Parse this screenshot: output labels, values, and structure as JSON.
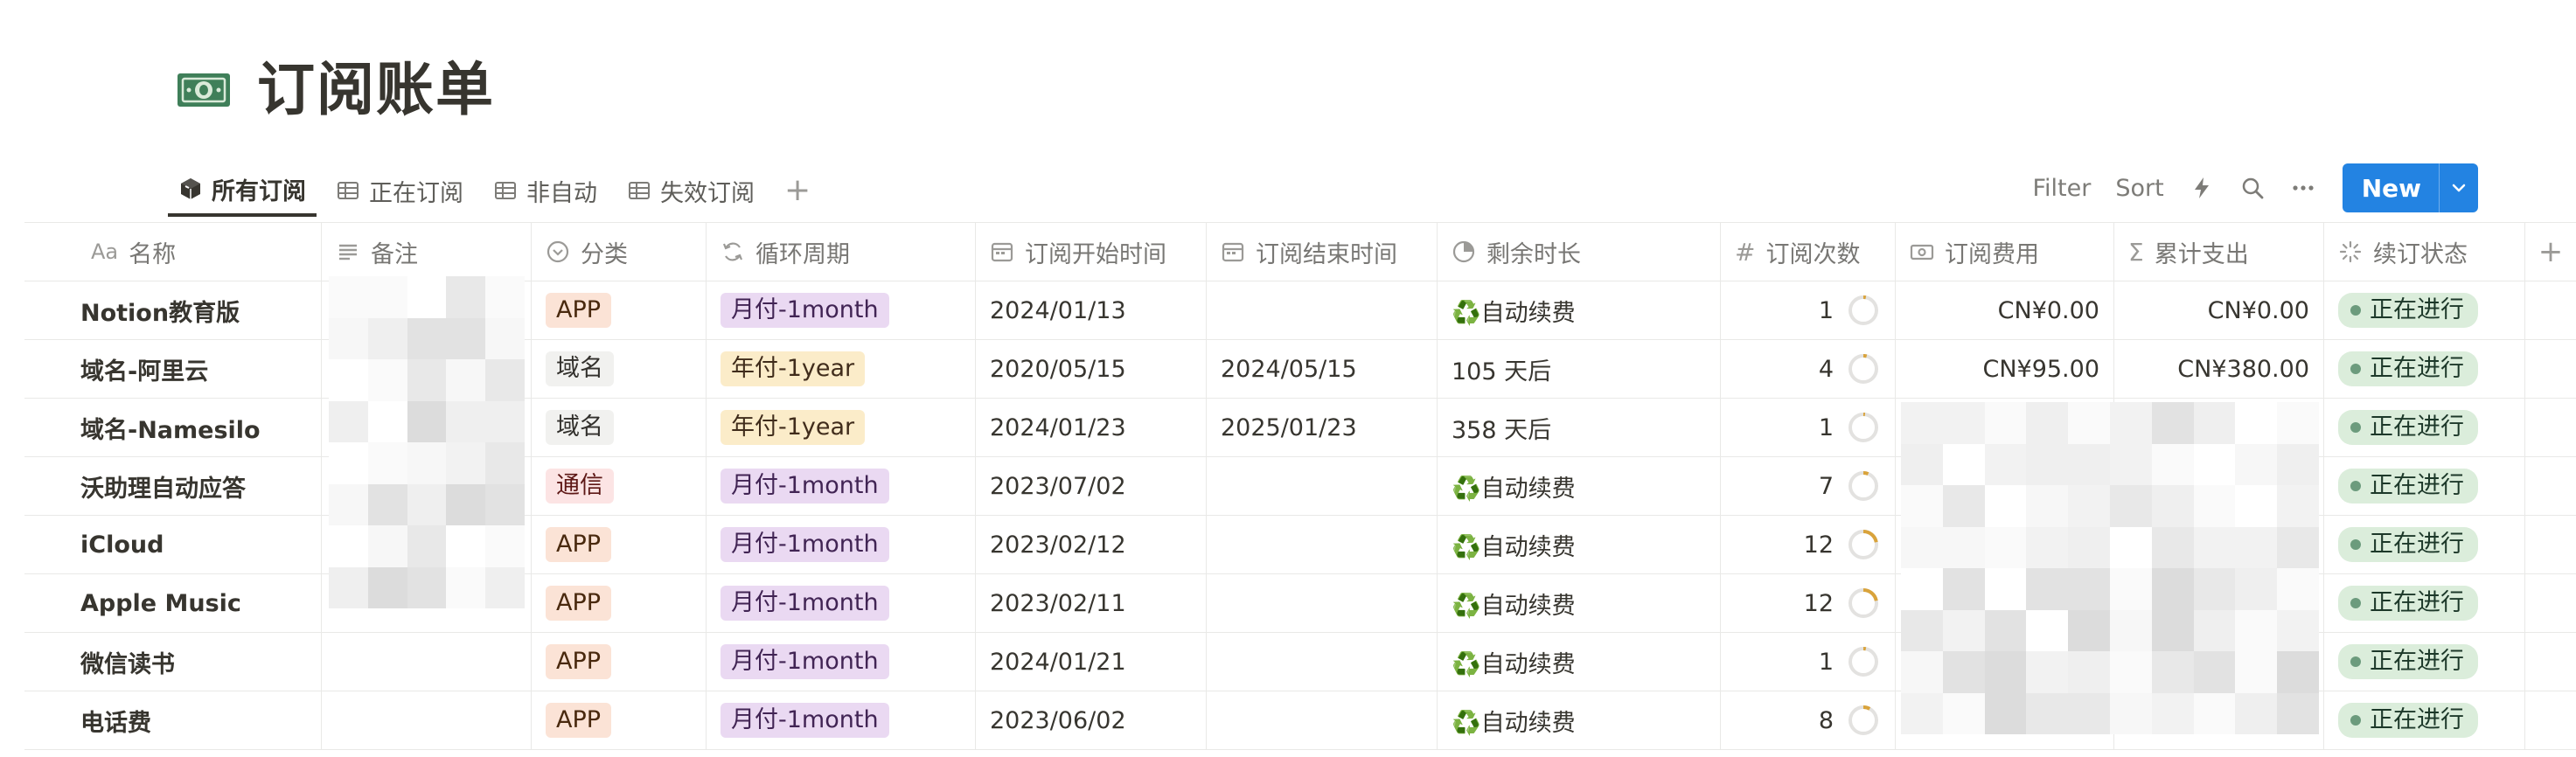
{
  "page": {
    "title": "订阅账单",
    "icon": "money-banknote-icon"
  },
  "tabs": [
    {
      "label": "所有订阅",
      "icon": "cube-icon",
      "active": true
    },
    {
      "label": "正在订阅",
      "icon": "table-icon",
      "active": false
    },
    {
      "label": "非自动",
      "icon": "table-icon",
      "active": false
    },
    {
      "label": "失效订阅",
      "icon": "table-icon",
      "active": false
    }
  ],
  "toolbar": {
    "filter_label": "Filter",
    "sort_label": "Sort",
    "new_label": "New"
  },
  "columns": [
    {
      "key": "name",
      "label": "名称",
      "icon_text": "Aa"
    },
    {
      "key": "note",
      "label": "备注",
      "icon": "text-lines-icon"
    },
    {
      "key": "category",
      "label": "分类",
      "icon": "select-icon"
    },
    {
      "key": "cycle",
      "label": "循环周期",
      "icon": "formula-icon"
    },
    {
      "key": "start",
      "label": "订阅开始时间",
      "icon": "calendar-icon"
    },
    {
      "key": "end",
      "label": "订阅结束时间",
      "icon": "calendar-icon"
    },
    {
      "key": "remaining",
      "label": "剩余时长",
      "icon": "pie-icon"
    },
    {
      "key": "count",
      "label": "订阅次数",
      "icon_text": "#"
    },
    {
      "key": "fee",
      "label": "订阅费用",
      "icon": "money-icon"
    },
    {
      "key": "total",
      "label": "累计支出",
      "icon_text": "Σ"
    },
    {
      "key": "status",
      "label": "续订状态",
      "icon": "status-icon"
    }
  ],
  "rows": [
    {
      "name": "Notion教育版",
      "category": "APP",
      "cat_type": "app",
      "cycle": "月付-1month",
      "cycle_type": "month",
      "start": "2024/01/13",
      "end": "",
      "remaining": "♻️自动续费",
      "count": "1",
      "count_progress": 0.03,
      "fee": "CN¥0.00",
      "total": "CN¥0.00",
      "status": "正在进行"
    },
    {
      "name": "域名-阿里云",
      "category": "域名",
      "cat_type": "domain",
      "cycle": "年付-1year",
      "cycle_type": "year",
      "start": "2020/05/15",
      "end": "2024/05/15",
      "remaining": "105 天后",
      "count": "4",
      "count_progress": 0.04,
      "fee": "CN¥95.00",
      "total": "CN¥380.00",
      "status": "正在进行"
    },
    {
      "name": "域名-Namesilo",
      "category": "域名",
      "cat_type": "domain",
      "cycle": "年付-1year",
      "cycle_type": "year",
      "start": "2024/01/23",
      "end": "2025/01/23",
      "remaining": "358 天后",
      "count": "1",
      "count_progress": 0.02,
      "fee": "",
      "total": "",
      "status": "正在进行"
    },
    {
      "name": "沃助理自动应答",
      "category": "通信",
      "cat_type": "tel",
      "cycle": "月付-1month",
      "cycle_type": "month",
      "start": "2023/07/02",
      "end": "",
      "remaining": "♻️自动续费",
      "count": "7",
      "count_progress": 0.06,
      "fee": "",
      "total": "",
      "status": "正在进行"
    },
    {
      "name": "iCloud",
      "category": "APP",
      "cat_type": "app",
      "cycle": "月付-1month",
      "cycle_type": "month",
      "start": "2023/02/12",
      "end": "",
      "remaining": "♻️自动续费",
      "count": "12",
      "count_progress": 0.22,
      "fee": "",
      "total": "",
      "status": "正在进行"
    },
    {
      "name": "Apple Music",
      "category": "APP",
      "cat_type": "app",
      "cycle": "月付-1month",
      "cycle_type": "month",
      "start": "2023/02/11",
      "end": "",
      "remaining": "♻️自动续费",
      "count": "12",
      "count_progress": 0.22,
      "fee": "",
      "total": "",
      "status": "正在进行"
    },
    {
      "name": "微信读书",
      "category": "APP",
      "cat_type": "app",
      "cycle": "月付-1month",
      "cycle_type": "month",
      "start": "2024/01/21",
      "end": "",
      "remaining": "♻️自动续费",
      "count": "1",
      "count_progress": 0.03,
      "fee": "",
      "total": "",
      "status": "正在进行"
    },
    {
      "name": "电话费",
      "category": "APP",
      "cat_type": "app",
      "cycle": "月付-1month",
      "cycle_type": "month",
      "start": "2023/06/02",
      "end": "",
      "remaining": "♻️自动续费",
      "count": "8",
      "count_progress": 0.08,
      "fee": "",
      "total": "",
      "status": "正在进行"
    }
  ],
  "colors": {
    "accent": "#2383e2",
    "ring_progress": "#d9a33b",
    "ring_track": "#e3e2e0",
    "status_bg": "#dbeddb",
    "status_dot": "#6c9b7d"
  }
}
